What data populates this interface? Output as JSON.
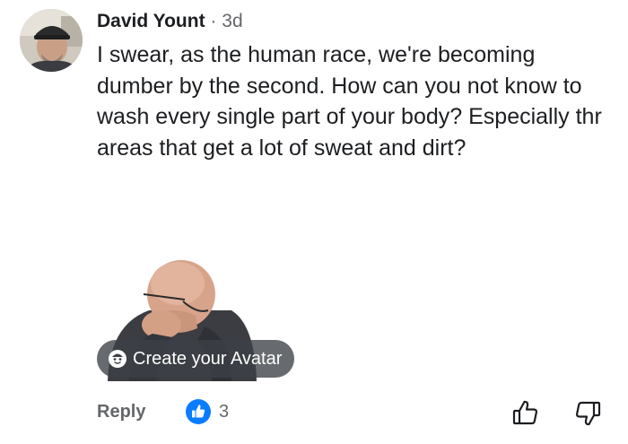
{
  "comment": {
    "author": "David Yount",
    "separator": "·",
    "time": "3d",
    "text": "I swear, as the human race, we're becoming dumber by the second. How can you not know to wash every single part of your body? Especially thr areas that get a lot of sweat and dirt?"
  },
  "sticker": {
    "cta_label": "Create your Avatar",
    "cta_icon": "avatar-face-icon"
  },
  "actions": {
    "reply_label": "Reply",
    "reaction_icon": "like-reaction-icon",
    "reaction_count": "3",
    "upvote_icon": "thumbs-up-icon",
    "downvote_icon": "thumbs-down-icon"
  },
  "colors": {
    "text": "#1c1e21",
    "secondary": "#65676b",
    "like_blue": "#0a7cff"
  }
}
